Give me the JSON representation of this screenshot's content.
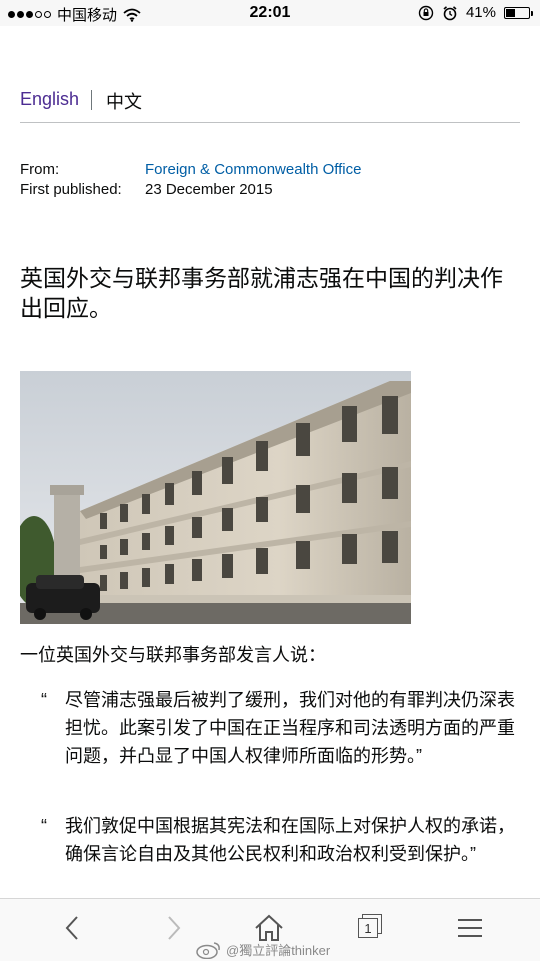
{
  "status_bar": {
    "carrier": "中国移动",
    "time": "22:01",
    "battery": "41%",
    "battery_level": 0.41,
    "signal_bars": 3,
    "icons": [
      "wifi-icon",
      "orientation-lock-icon",
      "alarm-icon",
      "battery-icon"
    ]
  },
  "language": {
    "english": "English",
    "chinese": "中文"
  },
  "meta": {
    "from_label": "From:",
    "from_value": "Foreign & Commonwealth Office",
    "published_label": "First published:",
    "published_value": "23 December 2015"
  },
  "article": {
    "title": "英国外交与联邦事务部就浦志强在中国的判决作出回应。",
    "lead": "一位英国外交与联邦事务部发言人说：",
    "quotes": [
      "尽管浦志强最后被判了缓刑，我们对他的有罪判决仍深表担忧。此案引发了中国在正当程序和司法透明方面的严重问题，并凸显了中国人权律师所面临的形势。”",
      "我们敦促中国根据其宪法和在国际上对保护人权的承诺，确保言论自由及其他公民权利和政治权利受到保护。”"
    ],
    "quote_mark": "“"
  },
  "toolbar": {
    "tab_count": "1",
    "icons": [
      "back-arrow-icon",
      "forward-arrow-icon",
      "home-icon",
      "tabs-icon",
      "menu-icon"
    ]
  },
  "watermark": {
    "text": "@獨立評論thinker"
  },
  "colors": {
    "link": "#005ea5",
    "language_link": "#4c2c92",
    "text": "#0b0c0c"
  }
}
